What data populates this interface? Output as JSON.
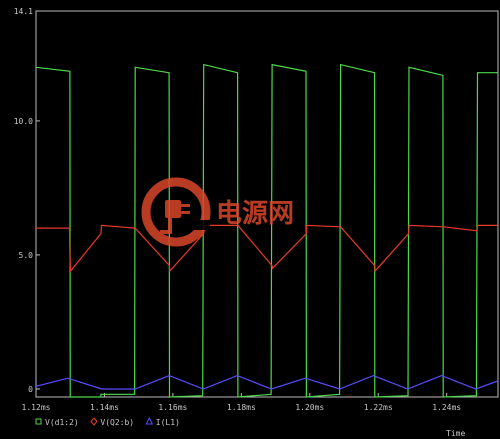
{
  "chart_data": {
    "type": "line",
    "x_unit": "ms",
    "xlim": [
      1.12,
      1.255
    ],
    "ylim": [
      -0.3,
      14.1
    ],
    "x_ticks": [
      "1.12ms",
      "1.14ms",
      "1.16ms",
      "1.18ms",
      "1.20ms",
      "1.22ms",
      "1.24ms"
    ],
    "x_tick_values": [
      1.12,
      1.14,
      1.16,
      1.18,
      1.2,
      1.22,
      1.24
    ],
    "y_ticks": [
      "0",
      "5.0",
      "10.0",
      "14.1"
    ],
    "y_tick_values": [
      0,
      5.0,
      10.0,
      14.1
    ],
    "xlabel": "Time",
    "grid": false,
    "legend_position": "bottom-left",
    "series": [
      {
        "name": "V(d1:2)",
        "color": "#4cd94c",
        "marker": "square",
        "x": [
          1.12,
          1.1299,
          1.13,
          1.1389,
          1.139,
          1.1488,
          1.149,
          1.1589,
          1.159,
          1.1687,
          1.169,
          1.1789,
          1.179,
          1.1887,
          1.189,
          1.1989,
          1.199,
          1.2087,
          1.209,
          1.2189,
          1.219,
          1.2287,
          1.229,
          1.2389,
          1.239,
          1.2487,
          1.249,
          1.255
        ],
        "y": [
          12.0,
          11.85,
          -0.3,
          -0.3,
          -0.2,
          -0.2,
          12.0,
          11.8,
          -0.3,
          -0.25,
          12.1,
          11.8,
          -0.3,
          -0.2,
          12.1,
          11.85,
          -0.3,
          -0.2,
          12.1,
          11.8,
          -0.3,
          -0.25,
          12.0,
          11.7,
          -0.3,
          -0.25,
          11.8,
          11.8
        ]
      },
      {
        "name": "V(Q2:b)",
        "color": "#e8392a",
        "marker": "diamond",
        "x": [
          1.12,
          1.1298,
          1.1299,
          1.1301,
          1.139,
          1.1391,
          1.1489,
          1.149,
          1.159,
          1.1591,
          1.169,
          1.1691,
          1.1789,
          1.179,
          1.189,
          1.1891,
          1.199,
          1.1991,
          1.2089,
          1.209,
          1.219,
          1.2191,
          1.2289,
          1.229,
          1.239,
          1.2391,
          1.2489,
          1.249,
          1.255
        ],
        "y": [
          6.0,
          6.0,
          5.0,
          4.4,
          5.8,
          6.1,
          6.0,
          6.0,
          4.6,
          4.4,
          5.8,
          6.1,
          6.1,
          6.1,
          4.6,
          4.5,
          5.8,
          6.1,
          6.05,
          6.05,
          4.6,
          4.4,
          5.8,
          6.1,
          6.05,
          6.05,
          5.9,
          6.1,
          6.1
        ]
      },
      {
        "name": "I(L1)",
        "color": "#5a4cff",
        "marker": "triangle",
        "x": [
          1.12,
          1.1293,
          1.1392,
          1.149,
          1.1589,
          1.1689,
          1.1788,
          1.1888,
          1.1987,
          1.2087,
          1.2186,
          1.2286,
          1.2385,
          1.2485,
          1.255
        ],
        "y": [
          0.1,
          0.4,
          0.0,
          0.0,
          0.5,
          0.0,
          0.5,
          0.0,
          0.4,
          0.0,
          0.5,
          0.0,
          0.5,
          0.0,
          0.3
        ]
      }
    ]
  },
  "watermark": {
    "logo_name": "power-plug-icon",
    "text": "电源网",
    "color": "#d9472b"
  }
}
